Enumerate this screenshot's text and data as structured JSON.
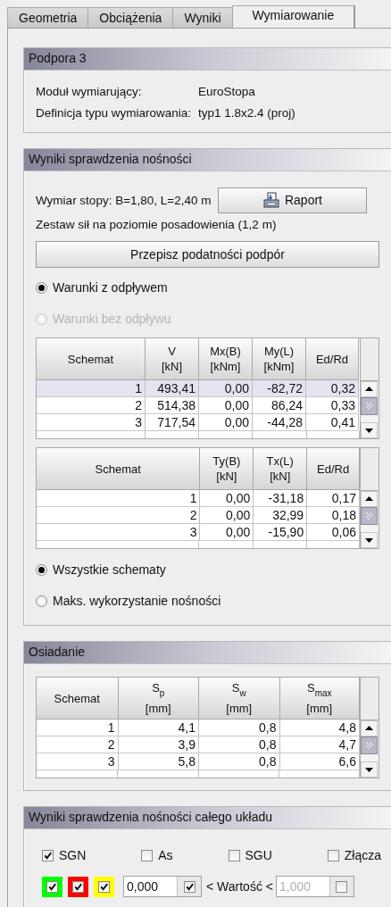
{
  "tabs": [
    {
      "label": "Geometria",
      "selected": false
    },
    {
      "label": "Obciążenia",
      "selected": false
    },
    {
      "label": "Wyniki",
      "selected": false
    },
    {
      "label": "Wymiarowanie",
      "selected": true
    }
  ],
  "support_panel": {
    "title": "Podpora 3",
    "fields": [
      {
        "label": "Moduł wymiarujący:",
        "value": "EuroStopa"
      },
      {
        "label": "Definicja typu wymiarowania:",
        "value": "typ1 1.8x2.4 (proj)"
      }
    ]
  },
  "capacity_panel": {
    "title": "Wyniki sprawdzenia nośności",
    "dimensions": "Wymiar stopy: B=1,80, L=2,40 m",
    "report_button": "Raport",
    "forces_label": "Zestaw sił na poziomie posadowienia (1,2 m)",
    "rewrite_button": "Przepisz podatności podpór",
    "conditions": [
      {
        "label": "Warunki z odpływem",
        "selected": true,
        "disabled": false
      },
      {
        "label": "Warunki bez odpływu",
        "selected": false,
        "disabled": true
      }
    ],
    "forces_table": {
      "columns": [
        "Schemat",
        "V [kN]",
        "Mx(B) [kNm]",
        "My(L) [kNm]",
        "Ed/Rd"
      ],
      "rows": [
        {
          "cells": [
            "1",
            "493,41",
            "0,00",
            "-82,72",
            "0,32"
          ],
          "selected": true
        },
        {
          "cells": [
            "2",
            "514,38",
            "0,00",
            "86,24",
            "0,33"
          ],
          "selected": false
        },
        {
          "cells": [
            "3",
            "717,54",
            "0,00",
            "-44,28",
            "0,41"
          ],
          "selected": false
        }
      ]
    },
    "shear_table": {
      "columns": [
        "Schemat",
        "Ty(B) [kN]",
        "Tx(L) [kN]",
        "Ed/Rd"
      ],
      "rows": [
        {
          "cells": [
            "1",
            "0,00",
            "-31,18",
            "0,17"
          ],
          "selected": false
        },
        {
          "cells": [
            "2",
            "0,00",
            "32,99",
            "0,18"
          ],
          "selected": false
        },
        {
          "cells": [
            "3",
            "0,00",
            "-15,90",
            "0,06"
          ],
          "selected": false
        }
      ]
    },
    "scope": [
      {
        "label": "Wszystkie schematy",
        "selected": true,
        "disabled": false
      },
      {
        "label": "Maks. wykorzystanie nośności",
        "selected": false,
        "disabled": false
      }
    ]
  },
  "settlement_panel": {
    "title": "Osiadanie",
    "table": {
      "columns": [
        "Schemat",
        "S$_{p}$ [mm]",
        "S$_{w}$ [mm]",
        "S$_{max}$ [mm]"
      ],
      "rows": [
        {
          "cells": [
            "1",
            "4,1",
            "0,8",
            "4,8"
          ],
          "selected": false
        },
        {
          "cells": [
            "2",
            "3,9",
            "0,8",
            "4,7"
          ],
          "selected": false
        },
        {
          "cells": [
            "3",
            "5,8",
            "0,8",
            "6,6"
          ],
          "selected": false
        }
      ]
    }
  },
  "system_panel": {
    "title": "Wyniki sprawdzenia nośności całego układu",
    "checks": [
      {
        "label": "SGN",
        "checked": true
      },
      {
        "label": "As",
        "checked": false
      },
      {
        "label": "SGU",
        "checked": false
      },
      {
        "label": "Złącza",
        "checked": false
      }
    ],
    "color_filters": [
      {
        "color": "#00ff00",
        "checked": true
      },
      {
        "color": "#ff0000",
        "checked": true
      },
      {
        "color": "#ffff00",
        "checked": true
      }
    ],
    "min_field": {
      "value": "0,000",
      "checked": true,
      "disabled": false
    },
    "range_label": "< Wartość <",
    "max_field": {
      "value": "1,000",
      "checked": false,
      "disabled": true
    }
  }
}
